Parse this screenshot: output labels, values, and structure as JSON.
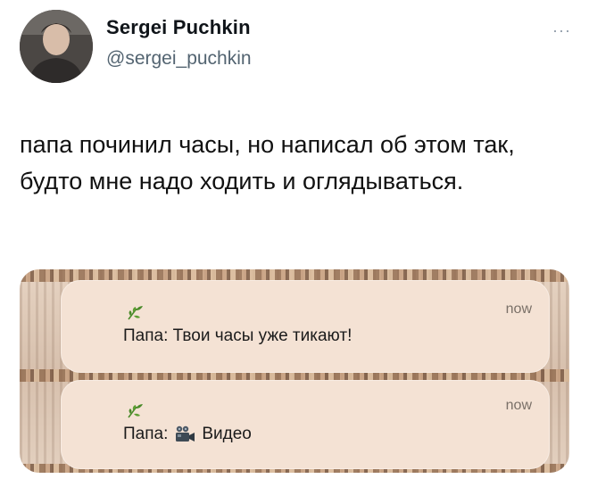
{
  "author": {
    "display_name": "Sergei Puchkin",
    "handle": "@sergei_puchkin"
  },
  "more_label": "···",
  "tweet": {
    "text": "папа починил часы, но написал об этом так, будто мне надо ходить и оглядываться."
  },
  "notifications": [
    {
      "time": "now",
      "message": "Папа: Твои часы уже тикают!",
      "icon": "leaf-icon"
    },
    {
      "time": "now",
      "sender": "Папа:",
      "attachment_label": "Видео",
      "icon": "leaf-icon",
      "attachment_icon": "video-camera-icon"
    }
  ],
  "colors": {
    "notification_bg": "#f4e2d4",
    "leaf": "#4a8a2a",
    "secondary_text": "#536471"
  }
}
